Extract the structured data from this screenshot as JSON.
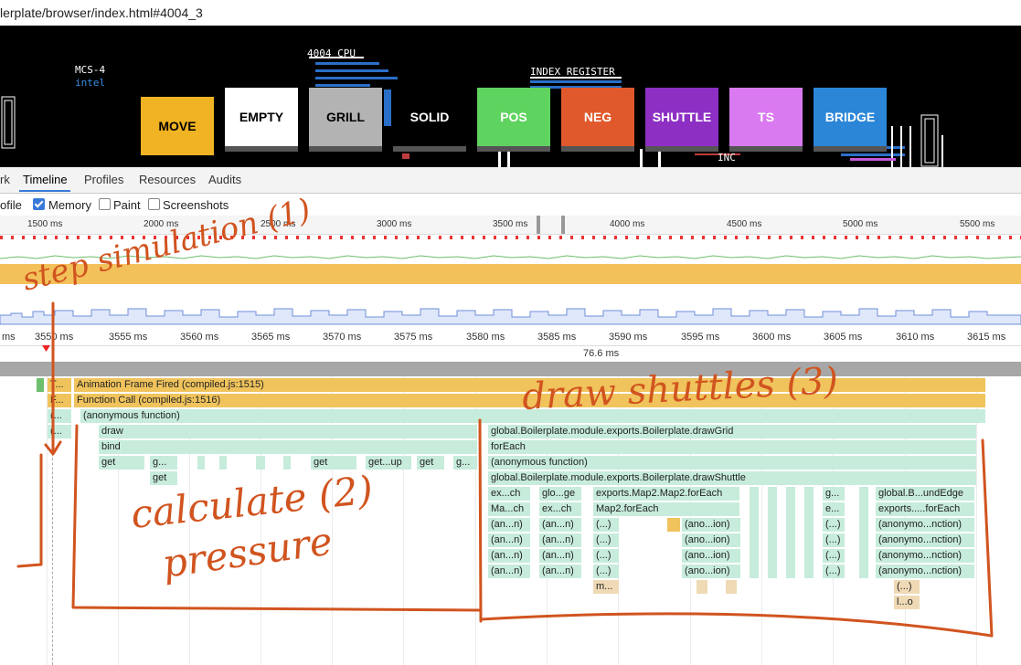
{
  "browser": {
    "url": "lerplate/browser/index.html#4004_3"
  },
  "app": {
    "chip_label": "MCS-4",
    "chip_brand": "intel",
    "cpu_label": "4004 CPU",
    "index_register_label": "INDEX REGISTER",
    "inc_label": "INC",
    "tools": [
      {
        "label": "MOVE",
        "color": "#f0b323"
      },
      {
        "label": "EMPTY",
        "color": "#ffffff"
      },
      {
        "label": "GRILL",
        "color": "#b3b3b3"
      },
      {
        "label": "SOLID",
        "color": "#000000"
      },
      {
        "label": "POS",
        "color": "#5fd35f"
      },
      {
        "label": "NEG",
        "color": "#e0592c"
      },
      {
        "label": "SHUTTLE",
        "color": "#8e2fc4"
      },
      {
        "label": "TS",
        "color": "#da7af0"
      },
      {
        "label": "BRIDGE",
        "color": "#2b86d8"
      }
    ]
  },
  "devtools": {
    "tabs": [
      "rk",
      "Timeline",
      "Profiles",
      "Resources",
      "Audits"
    ],
    "active_tab": "Timeline",
    "options": [
      {
        "label": "ofile",
        "checked": null
      },
      {
        "label": "Memory",
        "checked": true
      },
      {
        "label": "Paint",
        "checked": false
      },
      {
        "label": "Screenshots",
        "checked": false
      }
    ],
    "overview_ticks": [
      "1500 ms",
      "2000 ms",
      "2500 ms",
      "3000 ms",
      "3500 ms",
      "4000 ms",
      "4500 ms",
      "5000 ms",
      "5500 ms"
    ],
    "ruler_ticks": [
      "ms",
      "3550 ms",
      "3555 ms",
      "3560 ms",
      "3565 ms",
      "3570 ms",
      "3575 ms",
      "3580 ms",
      "3585 ms",
      "3590 ms",
      "3595 ms",
      "3600 ms",
      "3605 ms",
      "3610 ms",
      "3615 ms"
    ],
    "duration": "76.6 ms",
    "flame": {
      "animation_frame": "Animation Frame Fired (compiled.js:1515)",
      "function_call": "Function Call (compiled.js:1516)",
      "anonymous": "(anonymous function)",
      "t_short": "T...",
      "f_short": "F...",
      "paren": "(...",
      "draw": "draw",
      "bind": "bind",
      "get": "get",
      "g_short": "g...",
      "getup": "get...up",
      "drawGrid": "global.Boilerplate.module.exports.Boilerplate.drawGrid",
      "forEach": "forEach",
      "drawShuttle": "global.Boilerplate.module.exports.Boilerplate.drawShuttle",
      "ex_ch": "ex...ch",
      "glo_ge": "glo...ge",
      "map2_forEach_long": "exports.Map2.Map2.forEach",
      "ma_ch": "Ma...ch",
      "map2_forEach": "Map2.forEach",
      "e_short": "e...",
      "an_n": "(an...n)",
      "an_short": "(...)",
      "ano_ion": "(ano...ion)",
      "anonymo_nction": "(anonymo...nction)",
      "glob_undEdge": "global.B...undEdge",
      "exports_forEach": "exports.....forEach",
      "m_short": "m...",
      "l_o": "l...o"
    }
  },
  "annotations": {
    "step_simulation": "step simulation (1)",
    "calculate_pressure": "calculate (2)",
    "pressure": "pressure",
    "draw_shuttles": "draw shuttles (3)"
  }
}
